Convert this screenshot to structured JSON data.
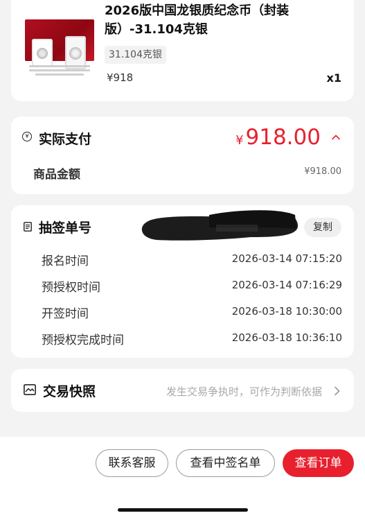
{
  "product": {
    "title": "2026版中国龙银质纪念币（封装版）-31.104克银",
    "spec": "31.104克银",
    "price": "¥918",
    "quantity": "x1"
  },
  "payment": {
    "title": "实际支付",
    "currency": "¥",
    "amount": "918.00",
    "goods_label": "商品金额",
    "goods_value": "¥918.00"
  },
  "lottery": {
    "title": "抽签单号",
    "copy_label": "复制",
    "rows": [
      {
        "label": "报名时间",
        "value": "2026-03-14 07:15:20"
      },
      {
        "label": "预授权时间",
        "value": "2026-03-14 07:16:29"
      },
      {
        "label": "开签时间",
        "value": "2026-03-18 10:30:00"
      },
      {
        "label": "预授权完成时间",
        "value": "2026-03-18 10:36:10"
      }
    ]
  },
  "snapshot": {
    "title": "交易快照",
    "hint": "发生交易争执时，可作为判断依据"
  },
  "actions": {
    "contact": "联系客服",
    "winning_list": "查看中签名单",
    "view_order": "查看订单"
  },
  "colors": {
    "accent": "#e8202e",
    "background": "#f3f3f3"
  },
  "icons": {
    "payment": "yen-circle-icon",
    "lottery": "doc-icon",
    "snapshot": "image-frame-icon",
    "expand": "chevron-up-icon",
    "enter": "chevron-right-icon"
  }
}
